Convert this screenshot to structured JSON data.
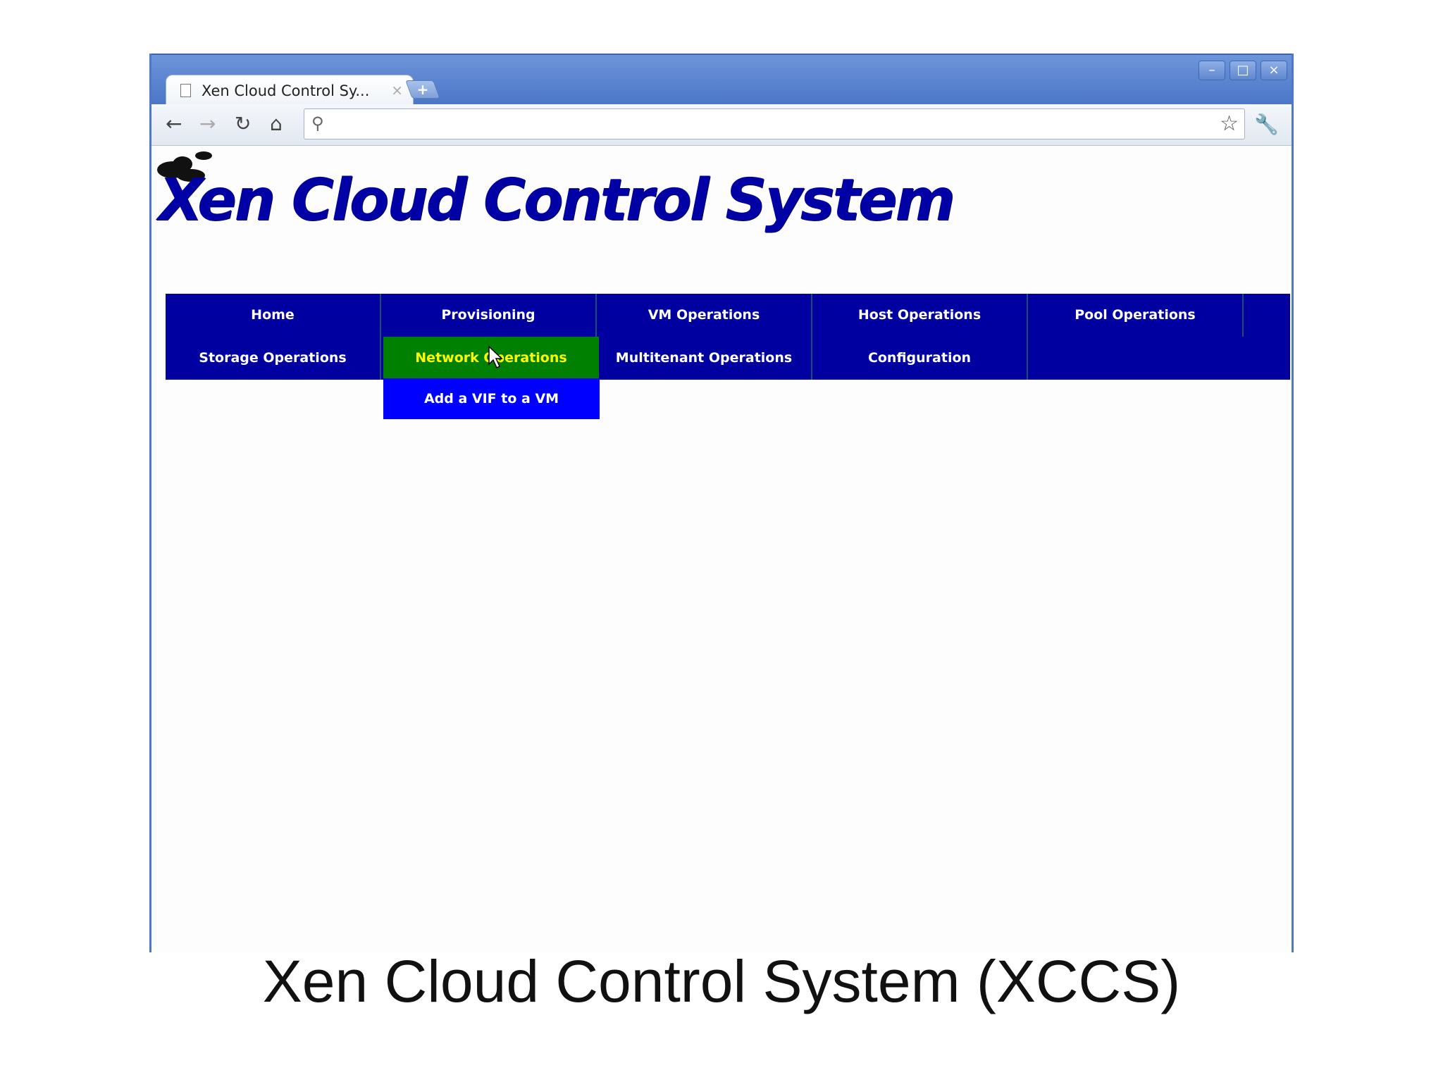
{
  "browser": {
    "tab_title": "Xen Cloud Control Sy...",
    "tab_close": "×",
    "new_tab": "+",
    "window_controls": [
      "–",
      "□",
      "×"
    ],
    "address_value": "",
    "icons": [
      "back-icon",
      "forward-icon",
      "reload-icon",
      "home-icon",
      "search-icon",
      "star-icon",
      "wrench-icon"
    ]
  },
  "page": {
    "logo_text": "Xen Cloud Control System",
    "menu": {
      "row1": [
        "Home",
        "Provisioning",
        "VM Operations",
        "Host Operations",
        "Pool Operations"
      ],
      "row2": [
        "Storage Operations",
        "Network Operations",
        "Multitenant Operations",
        "Configuration"
      ],
      "active_item": "Network Operations",
      "submenu": [
        "Add a VIF to a VM"
      ]
    },
    "colors": {
      "menu_bg": "#0000a0",
      "active_bg": "#008000",
      "active_text": "#ffff00",
      "submenu_bg": "#0000ff",
      "logo": "#0000a5"
    }
  },
  "caption": "Xen Cloud Control System (XCCS)"
}
